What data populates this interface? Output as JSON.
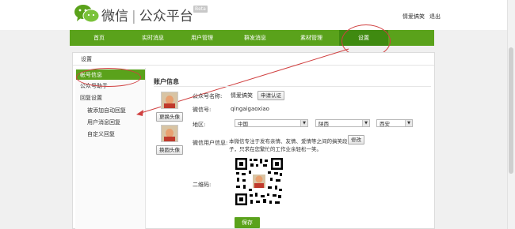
{
  "header": {
    "brand_name": "微信",
    "brand_sep": "|",
    "brand_sub": "公众平台",
    "beta": "Beta",
    "username": "情爱搞笑",
    "exit": "退出"
  },
  "nav": [
    "首页",
    "实时消息",
    "用户管理",
    "群发消息",
    "素材管理",
    "设置"
  ],
  "panel_title": "设置",
  "sidebar": {
    "items": [
      "帐号信息",
      "公众号助手",
      "回复设置",
      "被添加自动回复",
      "用户消息回复",
      "自定义回复"
    ]
  },
  "account": {
    "title": "账户信息",
    "change_avatar": "更换头像",
    "change_avatar2": "换圆头像",
    "name_label": "公众号名称:",
    "name_value": "情爱搞笑",
    "verify_button": "申请认证",
    "wechat_id_label": "微信号:",
    "wechat_id_value": "qingaigaoxiao",
    "region_label": "地区:",
    "country": "中国",
    "province": "陕西",
    "city": "西安",
    "intro_label": "微信用户信息:",
    "intro_value": "本微信专注于发布亲情、友情、爱情等之间的搞笑段子，只求在您繁忙的工作业余轻松一笑。",
    "edit_button": "修改",
    "qrcode_label": "二维码:",
    "save_button": "保存"
  },
  "colors": {
    "nav_green": "#5aa21b",
    "nav_active": "#3f8a10",
    "annotation_red": "#d04040"
  },
  "icons": [
    "wechat-logo-icon",
    "dropdown-arrow-icon",
    "qrcode-icon"
  ]
}
